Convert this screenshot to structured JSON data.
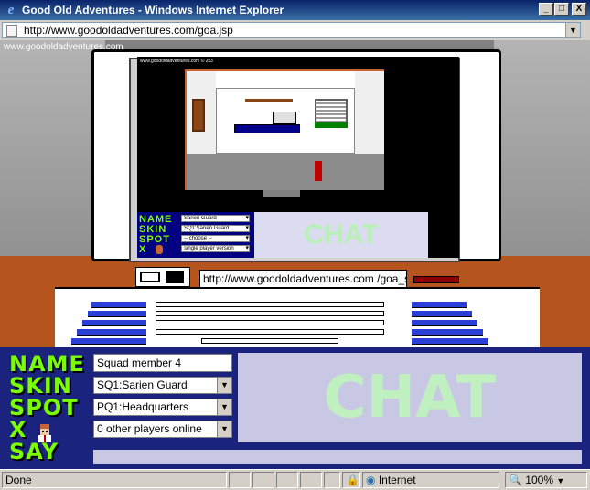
{
  "window": {
    "title": "Good Old Adventures - Windows Internet Explorer",
    "minimize": "_",
    "maximize": "□",
    "close": "X"
  },
  "address_bar": {
    "url": "http://www.goodoldadventures.com/goa.jsp"
  },
  "page": {
    "site_url": "www.goodoldadventures.com",
    "in_game": {
      "copyright": "www.goodoldadventures.com © 2k3",
      "words": [
        "NAME",
        "SKIN",
        "SPOT",
        "X"
      ],
      "name_value": "Sarien Guard",
      "skin_value": "SQ1:Sarien Guard",
      "spot_value": "-- choose --",
      "players_value": "single player version",
      "chat_label": "CHAT",
      "url_field": "http://www.goodoldadventures.com /goa_sin"
    },
    "panel": {
      "labels": {
        "name": "NAME",
        "skin": "SKIN",
        "spot": "SPOT",
        "x": "X",
        "say": "SAY"
      },
      "name_value": "Squad member 4",
      "skin_value": "SQ1:Sarien Guard",
      "spot_value": "PQ1:Headquarters",
      "players_value": "0 other players online",
      "chat_label": "CHAT",
      "say_value": ""
    }
  },
  "status_bar": {
    "status": "Done",
    "zone": "Internet",
    "zoom": "100%"
  },
  "colors": {
    "accent_green": "#7cfc00",
    "panel_blue": "#1a237e",
    "chat_bg": "#c8c8e4"
  }
}
